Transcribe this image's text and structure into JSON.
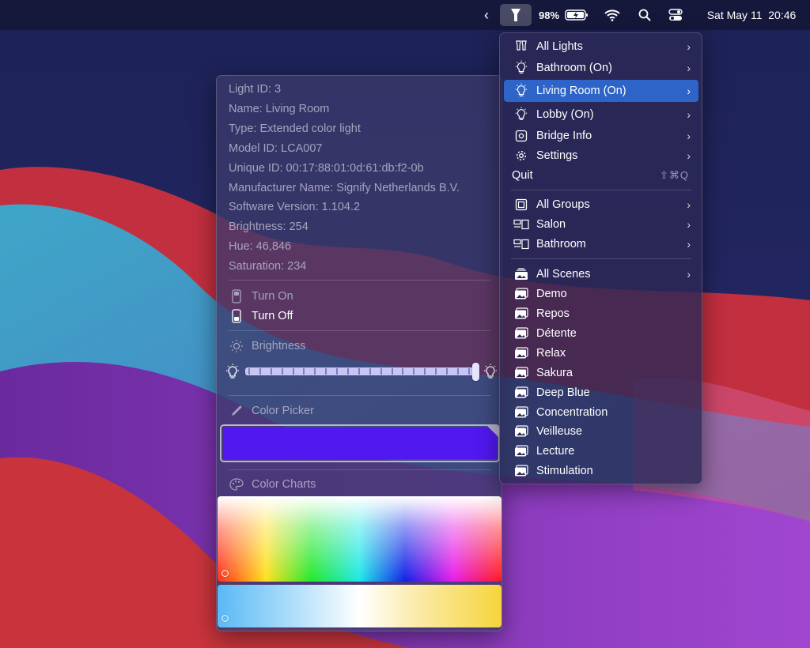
{
  "colors": {
    "selected_color": "#5218f0",
    "highlight": "#2e64c8"
  },
  "menubar": {
    "battery_pct": "98%",
    "datetime": "Sat May 11  20:46"
  },
  "menu": {
    "items": [
      {
        "label": "All Lights",
        "icon": "bulbs-icon"
      },
      {
        "label": "Bathroom (On)",
        "icon": "lightbulb-icon"
      },
      {
        "label": "Living Room (On)",
        "icon": "lightbulb-icon"
      },
      {
        "label": "Lobby (On)",
        "icon": "lightbulb-icon"
      },
      {
        "label": "Bridge Info",
        "icon": "bridge-icon"
      },
      {
        "label": "Settings",
        "icon": "gear-icon"
      }
    ],
    "quit": {
      "label": "Quit",
      "shortcut": "⇧⌘Q"
    },
    "groups": [
      {
        "label": "All Groups",
        "icon": "all-groups-icon"
      },
      {
        "label": "Salon",
        "icon": "group-icon"
      },
      {
        "label": "Bathroom",
        "icon": "group-icon"
      }
    ],
    "scenes": [
      {
        "label": "All Scenes",
        "icon": "scenes-icon"
      },
      {
        "label": "Demo",
        "icon": "scene-icon"
      },
      {
        "label": "Repos",
        "icon": "scene-icon"
      },
      {
        "label": "Détente",
        "icon": "scene-icon"
      },
      {
        "label": "Relax",
        "icon": "scene-icon"
      },
      {
        "label": "Sakura",
        "icon": "scene-icon"
      },
      {
        "label": "Deep Blue",
        "icon": "scene-icon"
      },
      {
        "label": "Concentration",
        "icon": "scene-icon"
      },
      {
        "label": "Veilleuse",
        "icon": "scene-icon"
      },
      {
        "label": "Lecture",
        "icon": "scene-icon"
      },
      {
        "label": "Stimulation",
        "icon": "scene-icon"
      }
    ]
  },
  "light_info": {
    "lines": [
      "Light ID: 3",
      "Name: Living Room",
      "Type: Extended color light",
      "Model ID: LCA007",
      "Unique ID: 00:17:88:01:0d:61:db:f2-0b",
      "Manufacturer Name: Signify Netherlands B.V.",
      "Software Version: 1.104.2",
      "Brightness: 254",
      "Hue: 46,846",
      "Saturation: 234"
    ],
    "turn_on": "Turn On",
    "turn_off": "Turn Off",
    "brightness_label": "Brightness",
    "brightness_value": 254,
    "brightness_max": 254,
    "color_picker_label": "Color Picker",
    "color_charts_label": "Color Charts"
  }
}
